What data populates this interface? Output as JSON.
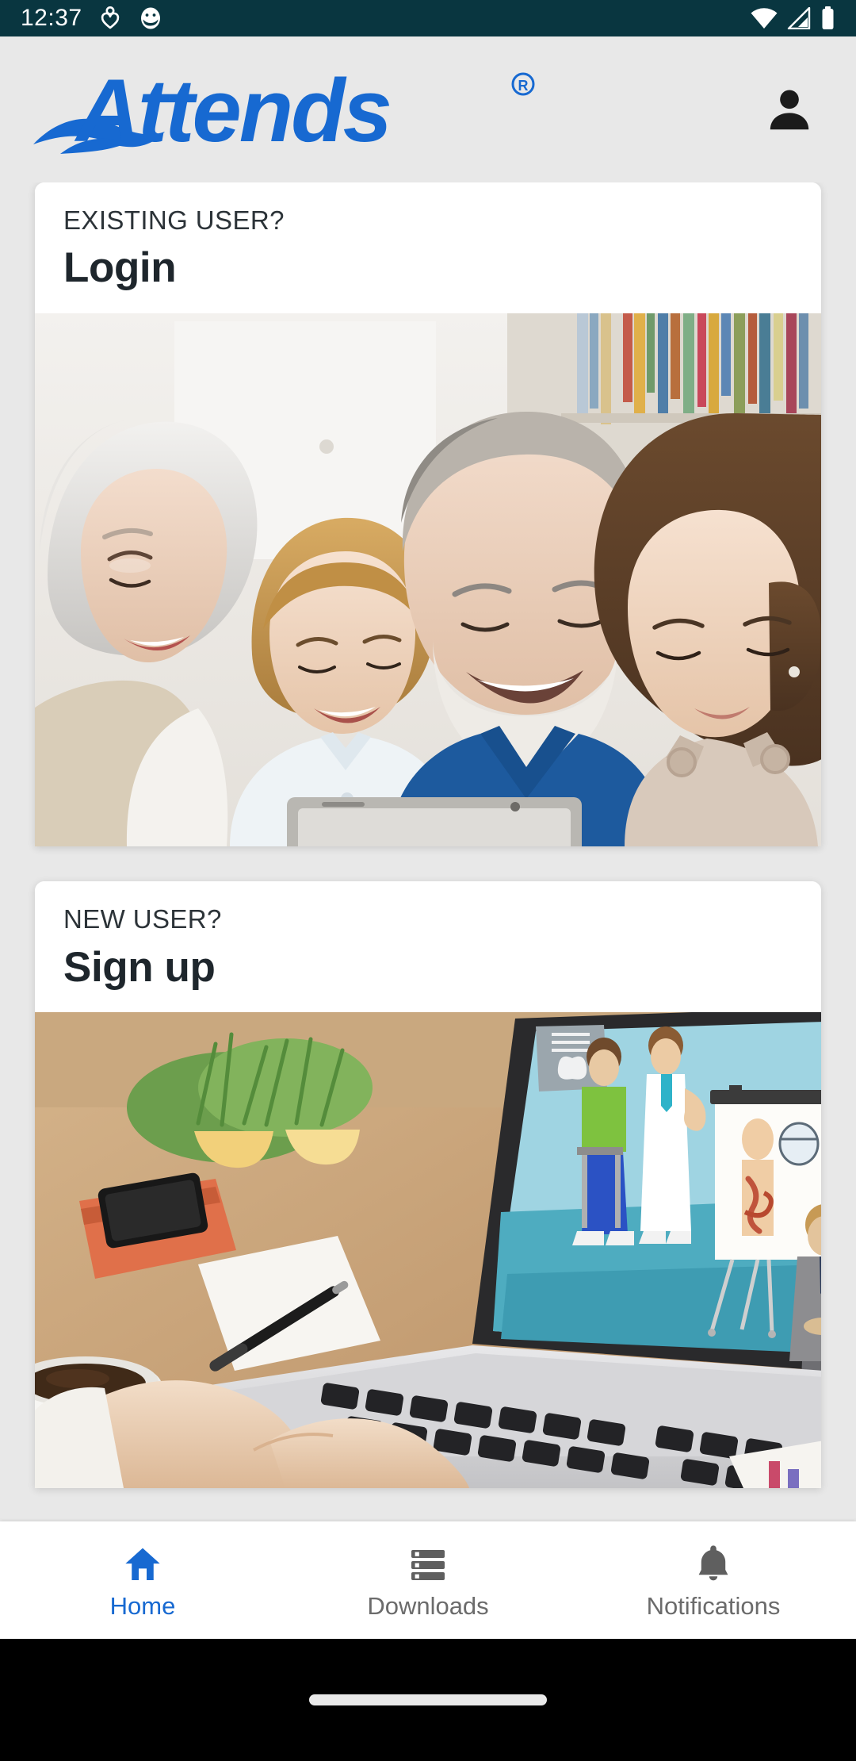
{
  "status_bar": {
    "time": "12:37",
    "left_icons": [
      "person-heart-icon",
      "app-badge-icon"
    ],
    "right_icons": [
      "wifi-icon",
      "signal-icon",
      "battery-icon"
    ],
    "background_color": "#093640",
    "foreground_color": "#ffffff"
  },
  "app_bar": {
    "brand": "Attends",
    "brand_trademark": "®",
    "brand_color": "#1769d1",
    "account_icon": "person-icon",
    "background_color": "#e8e8e8"
  },
  "cards": [
    {
      "kicker": "EXISTING USER?",
      "title": "Login",
      "image_alt": "Grandparents and two children smiling at a tablet"
    },
    {
      "kicker": "NEW USER?",
      "title": "Sign up",
      "image_alt": "Hands typing on a laptop showing a medical e-learning illustration"
    }
  ],
  "bottom_nav": {
    "active_color": "#1769d1",
    "inactive_color": "#6b6b6b",
    "items": [
      {
        "label": "Home",
        "icon": "home-icon",
        "active": true
      },
      {
        "label": "Downloads",
        "icon": "storage-list-icon",
        "active": false
      },
      {
        "label": "Notifications",
        "icon": "bell-icon",
        "active": false
      }
    ]
  },
  "gesture_bar": {
    "indicator": "home-gesture-pill"
  }
}
